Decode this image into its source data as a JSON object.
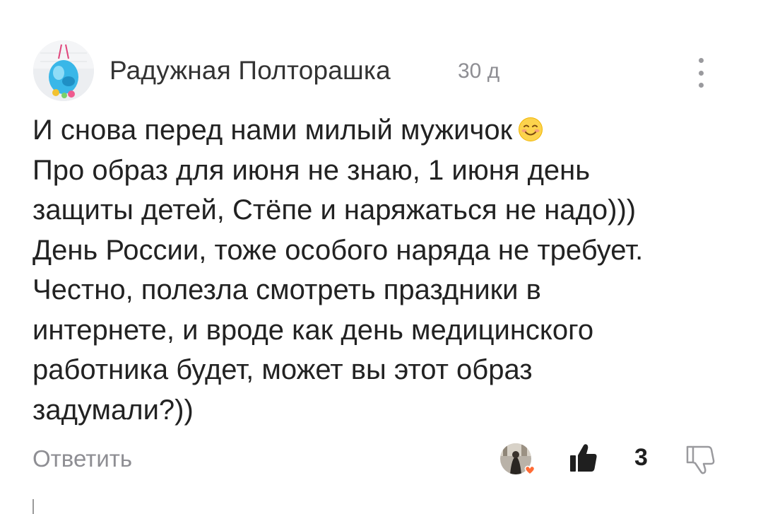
{
  "comment": {
    "author": {
      "name": "Радужная Полторашка",
      "avatar_icon": "avatar-picture-icon"
    },
    "timestamp": "30 д",
    "text_lines": [
      "И снова перед нами милый мужичок",
      "Про образ для июня не знаю, 1 июня день",
      "защиты детей, Стёпе и наряжаться не надо)))",
      "День России, тоже особого наряда не требует.",
      "Честно, полезла смотреть праздники в",
      "интернете, и вроде как день медицинского",
      "работника будет, может вы этот образ",
      "задумали?))"
    ],
    "emoji": "smiling-face-icon",
    "actions": {
      "reply_label": "Ответить",
      "like_count": "3",
      "like_icon": "thumbs-up-icon",
      "dislike_icon": "thumbs-down-icon",
      "liker_avatar_icon": "liker-avatar-icon",
      "heart_badge_color": "#ff6b35"
    }
  }
}
